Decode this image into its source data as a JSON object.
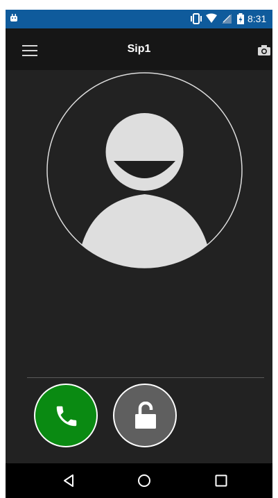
{
  "status_bar": {
    "time": "8:31",
    "icons": [
      "android-icon",
      "vibrate-icon",
      "wifi-icon",
      "signal-icon",
      "battery-icon"
    ]
  },
  "app_bar": {
    "title": "Sip1",
    "left_icon": "menu-icon",
    "right_icon": "camera-icon"
  },
  "contact": {
    "avatar_icon": "person-avatar-icon"
  },
  "actions": {
    "call_icon": "phone-icon",
    "unlock_icon": "unlock-icon"
  },
  "nav_bar": {
    "icons": [
      "back-icon",
      "home-icon",
      "recent-apps-icon"
    ]
  },
  "colors": {
    "status_bar": "#0f5b9c",
    "app_bar": "#161616",
    "background": "#222222",
    "call_button": "#0a8a12",
    "unlock_button": "#5f5f5f",
    "avatar_fill": "#dedede"
  }
}
